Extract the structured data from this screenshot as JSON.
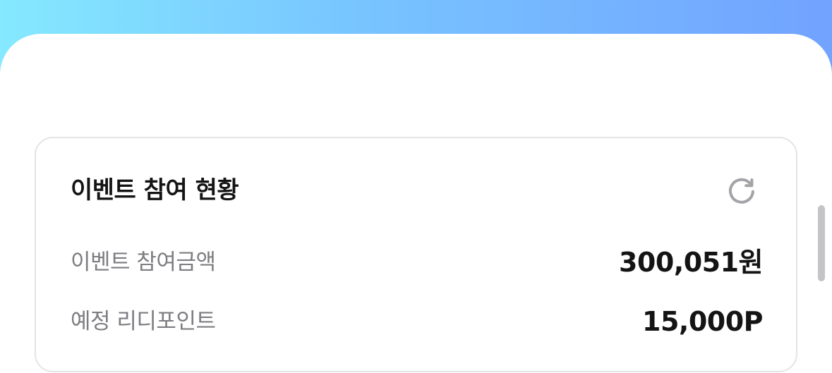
{
  "event_status": {
    "title": "이벤트 참여 현황",
    "refresh_icon": "refresh-icon",
    "rows": [
      {
        "label": "이벤트 참여금액",
        "value": "300,051원"
      },
      {
        "label": "예정 리디포인트",
        "value": "15,000P"
      }
    ]
  },
  "colors": {
    "header_gradient_start": "#85e9ff",
    "header_gradient_end": "#72a3ff",
    "label_gray": "#7d7d82",
    "value_black": "#141414",
    "card_border": "#e4e4e6"
  }
}
